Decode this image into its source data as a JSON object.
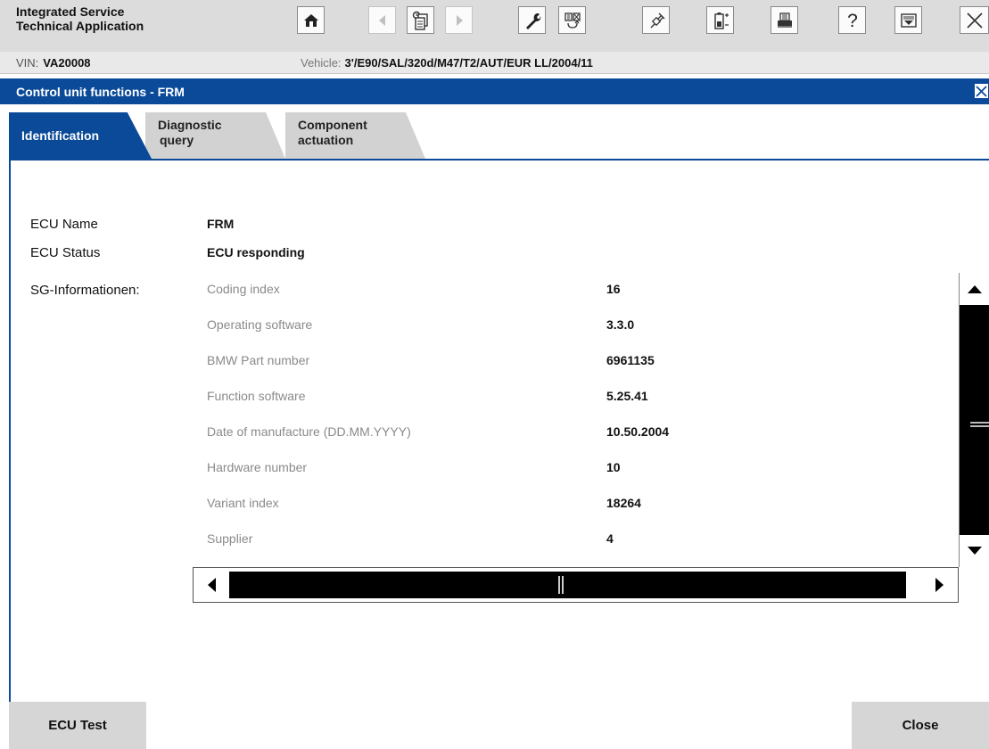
{
  "app": {
    "title_line1": "Integrated Service",
    "title_line2": "Technical Application"
  },
  "toolbar": {
    "buttons": [
      {
        "name": "home-icon",
        "enabled": true
      },
      {
        "name": "back-icon",
        "enabled": false
      },
      {
        "name": "documents-icon",
        "enabled": true
      },
      {
        "name": "forward-icon",
        "enabled": false
      },
      {
        "name": "wrench-icon",
        "enabled": true
      },
      {
        "name": "switch-view-icon",
        "enabled": true
      },
      {
        "name": "connection-icon",
        "enabled": true
      },
      {
        "name": "battery-icon",
        "enabled": true
      },
      {
        "name": "print-icon",
        "enabled": true
      },
      {
        "name": "help-icon",
        "enabled": true
      },
      {
        "name": "minimize-icon",
        "enabled": true
      },
      {
        "name": "close-icon",
        "enabled": true
      }
    ]
  },
  "vehicle": {
    "vin_label": "VIN:",
    "vin_value": "VA20008",
    "vehicle_label": "Vehicle:",
    "vehicle_value": "3'/E90/SAL/320d/M47/T2/AUT/EUR LL/2004/11"
  },
  "module": {
    "title": "Control unit functions - FRM"
  },
  "tabs": [
    {
      "line1": "Identification",
      "line2": "",
      "active": true
    },
    {
      "line1": "Diagnostic",
      "line2": "query",
      "active": false
    },
    {
      "line1": "Component",
      "line2": "actuation",
      "active": false
    }
  ],
  "ecu": {
    "name_label": "ECU Name",
    "name_value": "FRM",
    "status_label": "ECU Status",
    "status_value": "ECU responding",
    "sg_label": "SG-Informationen:"
  },
  "sg_info": [
    {
      "key": "Coding index",
      "value": "16"
    },
    {
      "key": "Operating software",
      "value": "3.3.0"
    },
    {
      "key": "BMW Part number",
      "value": "6961135"
    },
    {
      "key": "Function software",
      "value": "5.25.41"
    },
    {
      "key": "Date of manufacture (DD.MM.YYYY)",
      "value": "10.50.2004"
    },
    {
      "key": "Hardware number",
      "value": "10"
    },
    {
      "key": "Variant index",
      "value": "18264"
    },
    {
      "key": "Supplier",
      "value": "4"
    }
  ],
  "buttons": {
    "ecu_test": "ECU Test",
    "close": "Close"
  },
  "colors": {
    "accent": "#0a4a98",
    "header_bg": "#dcdcdc",
    "tab_inactive": "#d2d2d2",
    "muted_text": "#8a8a8a"
  }
}
